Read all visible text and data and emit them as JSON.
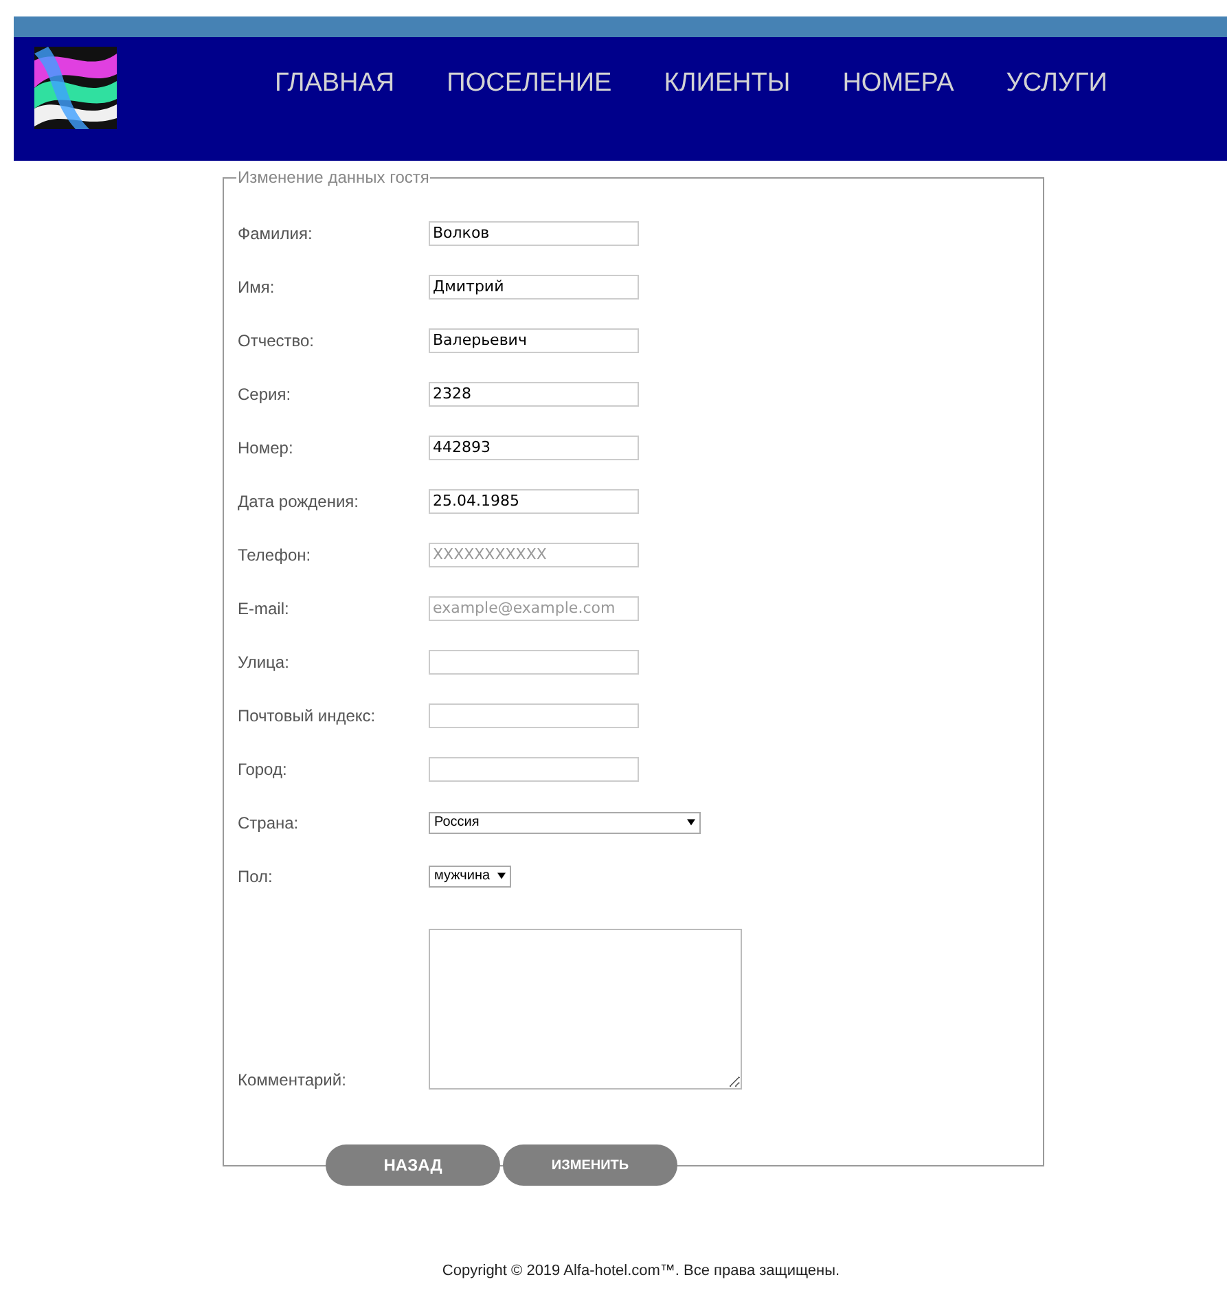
{
  "nav": {
    "items": [
      "ГЛАВНАЯ",
      "ПОСЕЛЕНИЕ",
      "КЛИЕНТЫ",
      "НОМЕРА",
      "УСЛУГИ"
    ]
  },
  "form": {
    "legend": "Изменение данных гостя",
    "fields": [
      {
        "kind": "text",
        "label": "Фамилия:",
        "value": "Волков"
      },
      {
        "kind": "text",
        "label": "Имя:",
        "value": "Дмитрий"
      },
      {
        "kind": "text",
        "label": "Отчество:",
        "value": "Валерьевич"
      },
      {
        "kind": "text",
        "label": "Серия:",
        "value": "2328"
      },
      {
        "kind": "text",
        "label": "Номер:",
        "value": "442893"
      },
      {
        "kind": "text",
        "label": "Дата рождения:",
        "value": "25.04.1985"
      },
      {
        "kind": "text",
        "label": "Телефон:",
        "placeholder": "XXXXXXXXXXX"
      },
      {
        "kind": "text",
        "label": "E-mail:",
        "placeholder": "example@example.com"
      },
      {
        "kind": "text",
        "label": "Улица:"
      },
      {
        "kind": "text",
        "label": "Почтовый индекс:"
      },
      {
        "kind": "text",
        "label": "Город:"
      },
      {
        "kind": "select-wide",
        "label": "Страна:",
        "value": "Россия"
      },
      {
        "kind": "select",
        "label": "Пол:",
        "value": "мужчина"
      },
      {
        "kind": "textarea",
        "label": "Комментарий:"
      }
    ],
    "buttons": [
      "НАЗАД",
      "ИЗМЕНИТЬ"
    ]
  },
  "footer": "Copyright © 2019 Alfa-hotel.com™. Все права защищены."
}
